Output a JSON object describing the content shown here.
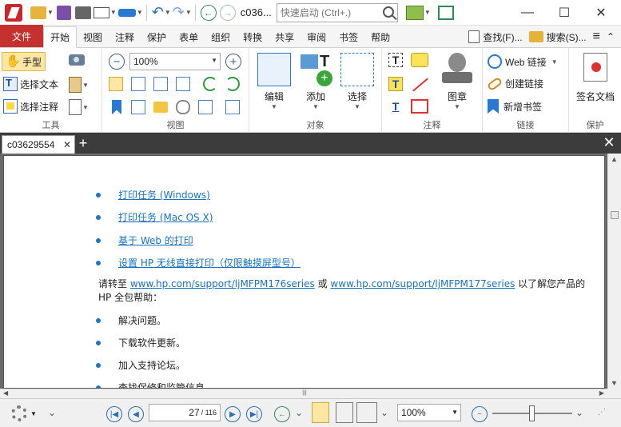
{
  "titlebar": {
    "title": "c036...",
    "search_placeholder": "快速启动 (Ctrl+.)",
    "minimize": "—",
    "maximize": "☐",
    "close": "✕"
  },
  "ribbon_tabs": {
    "file": "文件",
    "tabs": [
      "开始",
      "视图",
      "注释",
      "保护",
      "表单",
      "组织",
      "转换",
      "共享",
      "审阅",
      "书签",
      "帮助"
    ],
    "find": "查找(F)...",
    "search": "搜索(S)...",
    "menu": "≡",
    "collapse": "⌃"
  },
  "ribbon": {
    "tools": {
      "hand": "手型",
      "select_text": "选择文本",
      "select_annot": "选择注释",
      "label": "工具"
    },
    "view": {
      "zoom_value": "100%",
      "label": "视图"
    },
    "objects": {
      "edit": "编辑",
      "add": "添加",
      "select": "选择",
      "label": "对象"
    },
    "annotations": {
      "stamp": "图章",
      "label": "注释"
    },
    "links": {
      "web_link": "Web 链接",
      "create_link": "创建链接",
      "add_bookmark": "新增书签",
      "label": "链接"
    },
    "protect": {
      "sign": "签名文档",
      "label": "保护"
    }
  },
  "document": {
    "tab_name": "c03629554",
    "bullets": [
      "打印任务 (Windows)",
      "打印任务 (Mac OS X)",
      "基于 Web 的打印",
      "设置 HP 无线直接打印（仅限触摸屏型号）"
    ],
    "para_pre": "请转至 ",
    "link1": "www.hp.com/support/ljMFPM176series",
    "para_mid": " 或 ",
    "link2": "www.hp.com/support/ljMFPM177series",
    "para_post": " 以了解您产品的",
    "para_line2": "HP 全包帮助：",
    "tasks": [
      "解决问题。",
      "下载软件更新。",
      "加入支持论坛。",
      "查找保修和监管信息。"
    ]
  },
  "statusbar": {
    "current_page": "27",
    "total_pages": "/ 116",
    "zoom": "100%"
  }
}
